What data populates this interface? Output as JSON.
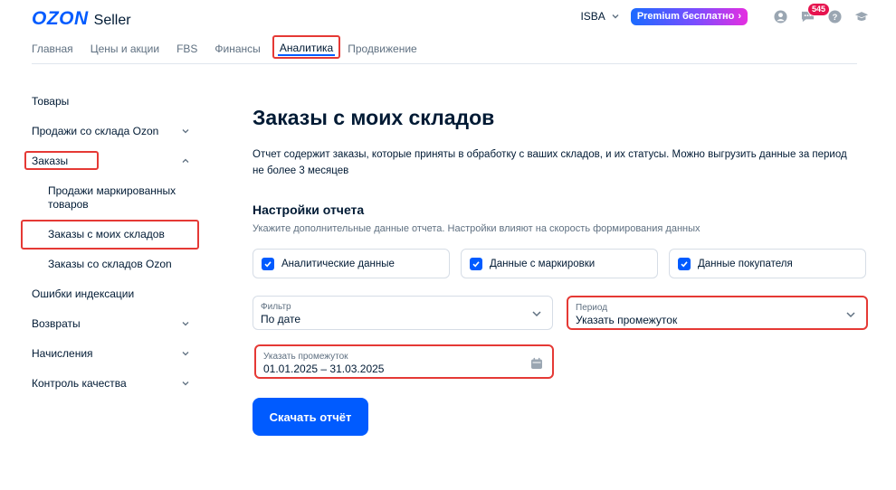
{
  "header": {
    "logo_brand": "OZON",
    "logo_product": "Seller",
    "account_name": "ISBA",
    "premium_label": "Premium бесплатно",
    "messages_badge": "545"
  },
  "topnav": {
    "items": [
      "Главная",
      "Цены и акции",
      "FBS",
      "Финансы",
      "Аналитика",
      "Продвижение"
    ],
    "active": "Аналитика"
  },
  "sidebar": {
    "items": [
      "Товары",
      "Продажи со склада Ozon",
      "Заказы",
      "Продажи маркированных товаров",
      "Заказы с моих складов",
      "Заказы со складов Ozon",
      "Ошибки индексации",
      "Возвраты",
      "Начисления",
      "Контроль качества"
    ]
  },
  "main": {
    "title": "Заказы с моих складов",
    "description": "Отчет содержит заказы, которые приняты в обработку с ваших складов, и их статусы. Можно выгрузить данные за период не более 3 месяцев",
    "settings_title": "Настройки отчета",
    "settings_subtitle": "Укажите дополнительные данные отчета. Настройки влияют на скорость формирования данных",
    "checkboxes": [
      "Аналитические данные",
      "Данные с маркировки",
      "Данные покупателя"
    ],
    "filter": {
      "label": "Фильтр",
      "value": "По дате"
    },
    "period": {
      "label": "Период",
      "value": "Указать промежуток"
    },
    "range": {
      "label": "Указать промежуток",
      "value": "01.01.2025 – 31.03.2025"
    },
    "download_label": "Скачать отчёт"
  },
  "colors": {
    "accent": "#005bff",
    "highlight": "#e53935"
  }
}
